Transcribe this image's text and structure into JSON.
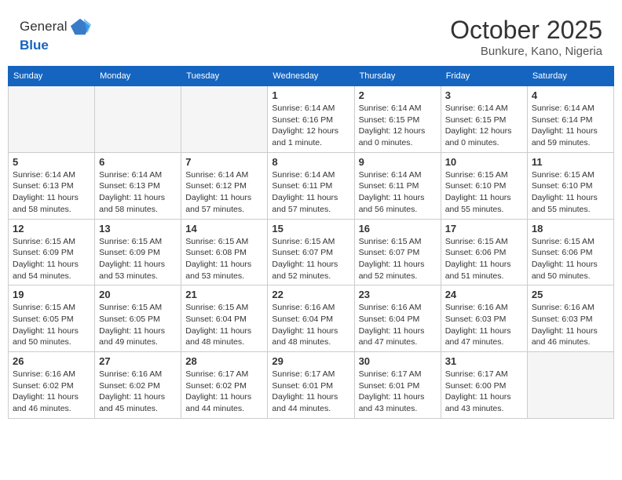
{
  "header": {
    "logo_line1": "General",
    "logo_line2": "Blue",
    "month_title": "October 2025",
    "location": "Bunkure, Kano, Nigeria"
  },
  "weekdays": [
    "Sunday",
    "Monday",
    "Tuesday",
    "Wednesday",
    "Thursday",
    "Friday",
    "Saturday"
  ],
  "weeks": [
    [
      {
        "day": "",
        "info": ""
      },
      {
        "day": "",
        "info": ""
      },
      {
        "day": "",
        "info": ""
      },
      {
        "day": "1",
        "info": "Sunrise: 6:14 AM\nSunset: 6:16 PM\nDaylight: 12 hours\nand 1 minute."
      },
      {
        "day": "2",
        "info": "Sunrise: 6:14 AM\nSunset: 6:15 PM\nDaylight: 12 hours\nand 0 minutes."
      },
      {
        "day": "3",
        "info": "Sunrise: 6:14 AM\nSunset: 6:15 PM\nDaylight: 12 hours\nand 0 minutes."
      },
      {
        "day": "4",
        "info": "Sunrise: 6:14 AM\nSunset: 6:14 PM\nDaylight: 11 hours\nand 59 minutes."
      }
    ],
    [
      {
        "day": "5",
        "info": "Sunrise: 6:14 AM\nSunset: 6:13 PM\nDaylight: 11 hours\nand 58 minutes."
      },
      {
        "day": "6",
        "info": "Sunrise: 6:14 AM\nSunset: 6:13 PM\nDaylight: 11 hours\nand 58 minutes."
      },
      {
        "day": "7",
        "info": "Sunrise: 6:14 AM\nSunset: 6:12 PM\nDaylight: 11 hours\nand 57 minutes."
      },
      {
        "day": "8",
        "info": "Sunrise: 6:14 AM\nSunset: 6:11 PM\nDaylight: 11 hours\nand 57 minutes."
      },
      {
        "day": "9",
        "info": "Sunrise: 6:14 AM\nSunset: 6:11 PM\nDaylight: 11 hours\nand 56 minutes."
      },
      {
        "day": "10",
        "info": "Sunrise: 6:15 AM\nSunset: 6:10 PM\nDaylight: 11 hours\nand 55 minutes."
      },
      {
        "day": "11",
        "info": "Sunrise: 6:15 AM\nSunset: 6:10 PM\nDaylight: 11 hours\nand 55 minutes."
      }
    ],
    [
      {
        "day": "12",
        "info": "Sunrise: 6:15 AM\nSunset: 6:09 PM\nDaylight: 11 hours\nand 54 minutes."
      },
      {
        "day": "13",
        "info": "Sunrise: 6:15 AM\nSunset: 6:09 PM\nDaylight: 11 hours\nand 53 minutes."
      },
      {
        "day": "14",
        "info": "Sunrise: 6:15 AM\nSunset: 6:08 PM\nDaylight: 11 hours\nand 53 minutes."
      },
      {
        "day": "15",
        "info": "Sunrise: 6:15 AM\nSunset: 6:07 PM\nDaylight: 11 hours\nand 52 minutes."
      },
      {
        "day": "16",
        "info": "Sunrise: 6:15 AM\nSunset: 6:07 PM\nDaylight: 11 hours\nand 52 minutes."
      },
      {
        "day": "17",
        "info": "Sunrise: 6:15 AM\nSunset: 6:06 PM\nDaylight: 11 hours\nand 51 minutes."
      },
      {
        "day": "18",
        "info": "Sunrise: 6:15 AM\nSunset: 6:06 PM\nDaylight: 11 hours\nand 50 minutes."
      }
    ],
    [
      {
        "day": "19",
        "info": "Sunrise: 6:15 AM\nSunset: 6:05 PM\nDaylight: 11 hours\nand 50 minutes."
      },
      {
        "day": "20",
        "info": "Sunrise: 6:15 AM\nSunset: 6:05 PM\nDaylight: 11 hours\nand 49 minutes."
      },
      {
        "day": "21",
        "info": "Sunrise: 6:15 AM\nSunset: 6:04 PM\nDaylight: 11 hours\nand 48 minutes."
      },
      {
        "day": "22",
        "info": "Sunrise: 6:16 AM\nSunset: 6:04 PM\nDaylight: 11 hours\nand 48 minutes."
      },
      {
        "day": "23",
        "info": "Sunrise: 6:16 AM\nSunset: 6:04 PM\nDaylight: 11 hours\nand 47 minutes."
      },
      {
        "day": "24",
        "info": "Sunrise: 6:16 AM\nSunset: 6:03 PM\nDaylight: 11 hours\nand 47 minutes."
      },
      {
        "day": "25",
        "info": "Sunrise: 6:16 AM\nSunset: 6:03 PM\nDaylight: 11 hours\nand 46 minutes."
      }
    ],
    [
      {
        "day": "26",
        "info": "Sunrise: 6:16 AM\nSunset: 6:02 PM\nDaylight: 11 hours\nand 46 minutes."
      },
      {
        "day": "27",
        "info": "Sunrise: 6:16 AM\nSunset: 6:02 PM\nDaylight: 11 hours\nand 45 minutes."
      },
      {
        "day": "28",
        "info": "Sunrise: 6:17 AM\nSunset: 6:02 PM\nDaylight: 11 hours\nand 44 minutes."
      },
      {
        "day": "29",
        "info": "Sunrise: 6:17 AM\nSunset: 6:01 PM\nDaylight: 11 hours\nand 44 minutes."
      },
      {
        "day": "30",
        "info": "Sunrise: 6:17 AM\nSunset: 6:01 PM\nDaylight: 11 hours\nand 43 minutes."
      },
      {
        "day": "31",
        "info": "Sunrise: 6:17 AM\nSunset: 6:00 PM\nDaylight: 11 hours\nand 43 minutes."
      },
      {
        "day": "",
        "info": ""
      }
    ]
  ]
}
